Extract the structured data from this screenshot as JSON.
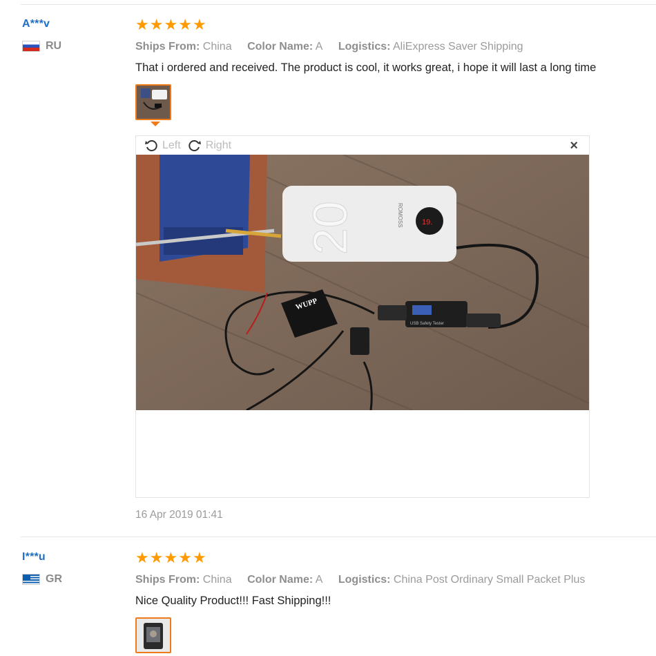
{
  "reviews": [
    {
      "username": "A***v",
      "country": "RU",
      "flag_icon": "flag-russia-icon",
      "rating": 5,
      "ships_from_label": "Ships From:",
      "ships_from": "China",
      "color_label": "Color Name:",
      "color": "A",
      "logistics_label": "Logistics:",
      "logistics": "AliExpress Saver Shipping",
      "text": "That i ordered and received. The product is cool, it works great, i hope it will last a long time",
      "date": "16 Apr 2019 01:41"
    },
    {
      "username": "I***u",
      "country": "GR",
      "flag_icon": "flag-greece-icon",
      "rating": 5,
      "ships_from_label": "Ships From:",
      "ships_from": "China",
      "color_label": "Color Name:",
      "color": "A",
      "logistics_label": "Logistics:",
      "logistics": "China Post Ordinary Small Packet Plus",
      "text": "Nice Quality Product!!! Fast Shipping!!!"
    }
  ],
  "viewer": {
    "rotate_left": "Left",
    "rotate_right": "Right",
    "close_icon": "×",
    "photo_texts": {
      "brand": "ROMOSS",
      "display": "19.",
      "capacity": "20",
      "module": "WUPP",
      "tester": "USB Safety Tester"
    }
  },
  "colors": {
    "star": "#ff9a00",
    "username": "#1f6fc5",
    "thumb_border": "#f07a1a"
  }
}
